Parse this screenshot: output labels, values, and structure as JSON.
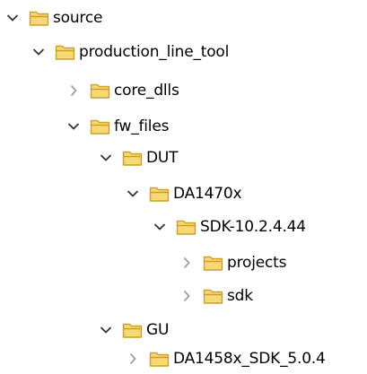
{
  "tree": {
    "items": [
      {
        "label": "source",
        "expanded": true,
        "depth": 0
      },
      {
        "label": "production_line_tool",
        "expanded": true,
        "depth": 1
      },
      {
        "label": "core_dlls",
        "expanded": false,
        "depth": 2
      },
      {
        "label": "fw_files",
        "expanded": true,
        "depth": 2
      },
      {
        "label": "DUT",
        "expanded": true,
        "depth": 3
      },
      {
        "label": "DA1470x",
        "expanded": true,
        "depth": 4
      },
      {
        "label": "SDK-10.2.4.44",
        "expanded": true,
        "depth": 5
      },
      {
        "label": "projects",
        "expanded": false,
        "depth": 6
      },
      {
        "label": "sdk",
        "expanded": false,
        "depth": 6
      },
      {
        "label": "GU",
        "expanded": true,
        "depth": 3
      },
      {
        "label": "DA1458x_SDK_5.0.4",
        "expanded": false,
        "depth": 4
      }
    ]
  },
  "colors": {
    "folder_fill": "#F8D775",
    "folder_outline": "#C9A227",
    "chevron_expanded": "#333333",
    "chevron_collapsed": "#A0A0A0"
  },
  "icons": {
    "expanded": "chevron-down-icon",
    "collapsed": "chevron-right-icon",
    "folder": "folder-icon"
  }
}
